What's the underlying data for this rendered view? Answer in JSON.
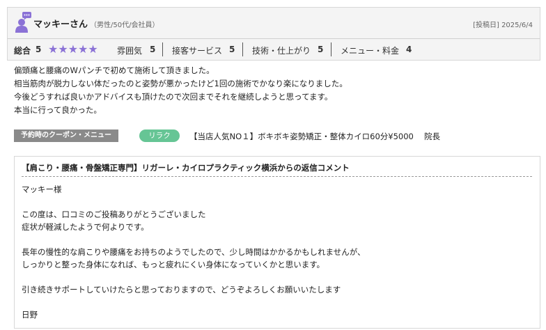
{
  "reviewer": {
    "name": "マッキーさん",
    "meta": "（男性/50代/会社員）",
    "post_date": "[投稿日] 2025/6/4"
  },
  "ratings": {
    "overall_label": "総合",
    "overall_score": "5",
    "stars": "★★★★★",
    "star_count": 5,
    "star_color": "#8b72d6",
    "categories": [
      {
        "label": "雰囲気",
        "score": "5"
      },
      {
        "label": "接客サービス",
        "score": "5"
      },
      {
        "label": "技術・仕上がり",
        "score": "5"
      },
      {
        "label": "メニュー・料金",
        "score": "4"
      }
    ]
  },
  "review_body": [
    "偏頭痛と腰痛のWパンチで初めて施術して頂きました。",
    "相当筋肉が脱力しない体だったのと姿勢が悪かったけど1回の施術でかなり楽になりました。",
    "今後どうすれば良いかアドバイスも頂けたので次回までそれを継続しようと思ってます。",
    "本当に行って良かった。"
  ],
  "coupon": {
    "label": "予約時のクーポン・メニュー",
    "tag": "リラク",
    "tag_color": "#66c595",
    "menu": "【当店人気NO１】ボキボキ姿勢矯正・整体カイロ60分¥5000　 院長"
  },
  "reply": {
    "title": "【肩こり・腰痛・骨盤矯正専門】リガーレ・カイロプラクティック横浜からの返信コメント",
    "lines": [
      "マッキー様",
      "",
      "この度は、口コミのご投稿ありがとうございました",
      "症状が軽減したようで何よりです。",
      "",
      "長年の慢性的な肩こりや腰痛をお持ちのようでしたので、少し時間はかかるかもしれませんが、",
      "しっかりと整った身体になれば、もっと疲れにくい身体になっていくかと思います。",
      "",
      "引き続きサポートしていけたらと思っておりますので、どうぞよろしくお願いいたします",
      "",
      "日野"
    ]
  }
}
